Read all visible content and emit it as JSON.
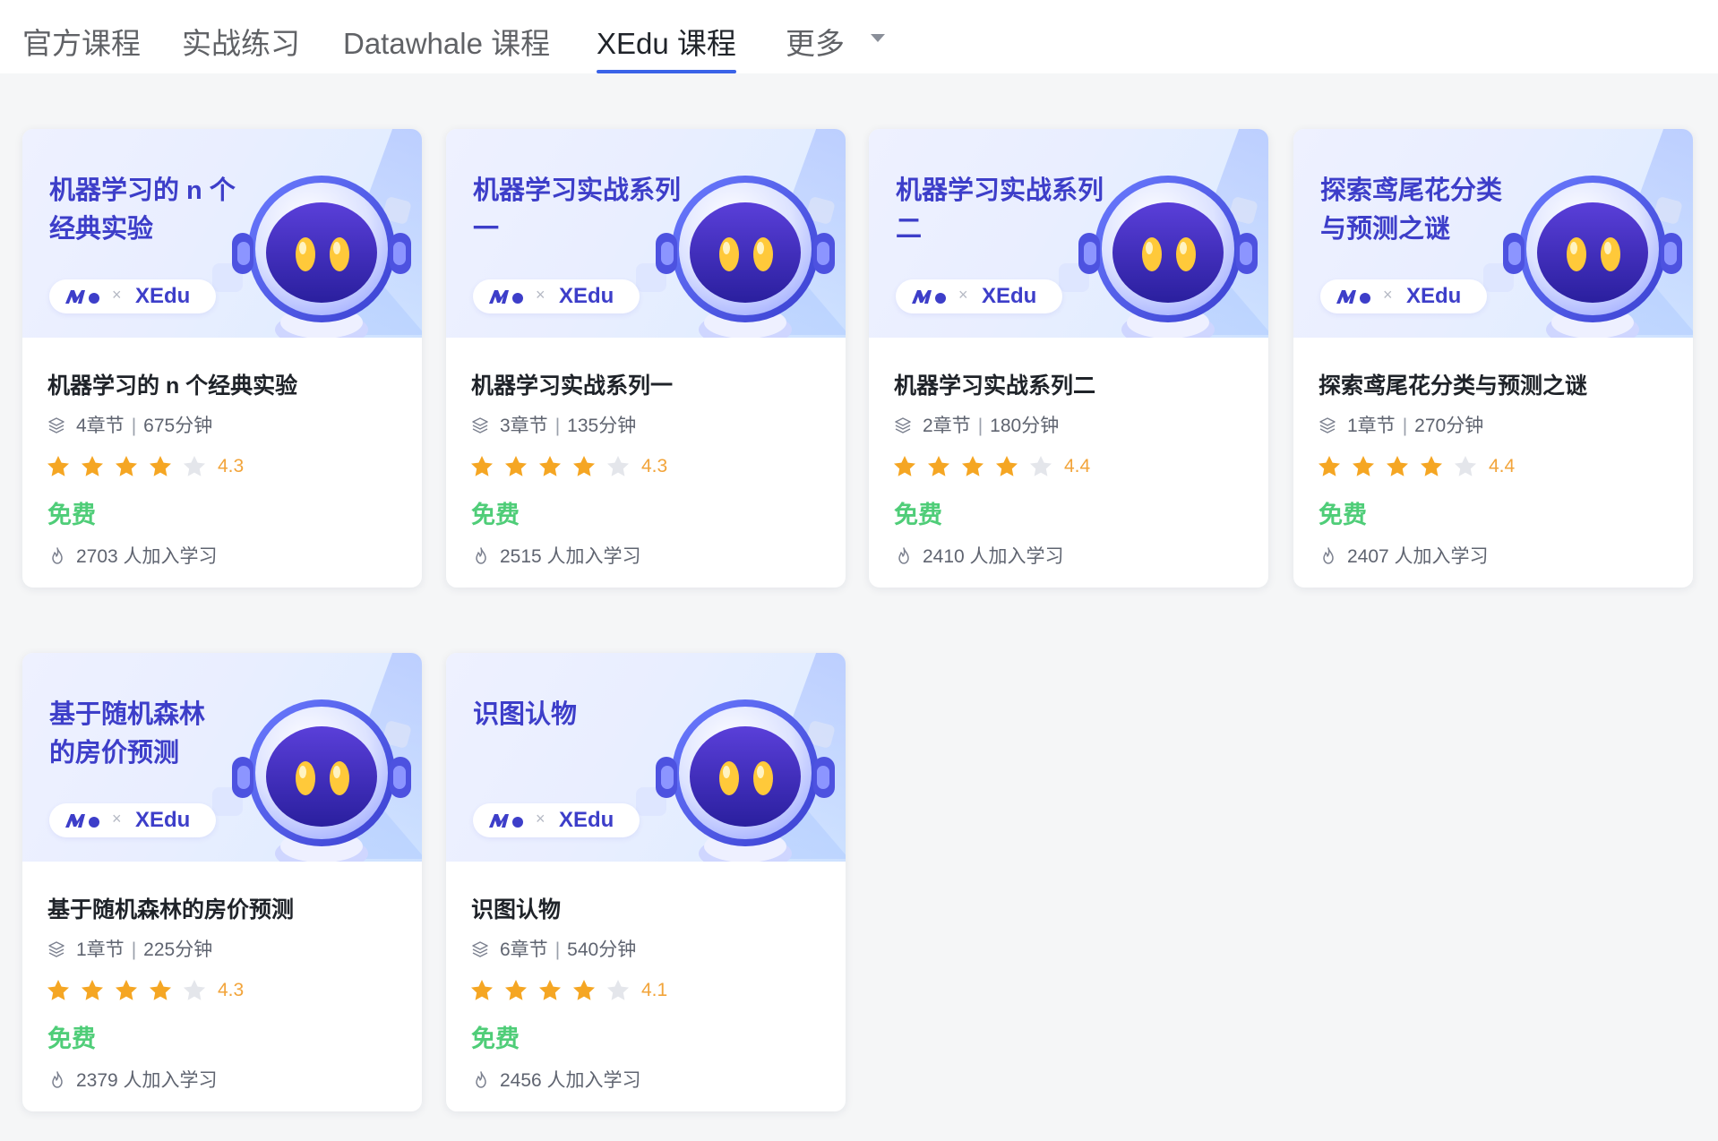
{
  "tabs": [
    {
      "label": "官方课程",
      "active": false
    },
    {
      "label": "实战练习",
      "active": false
    },
    {
      "label": "Datawhale 课程",
      "active": false
    },
    {
      "label": "XEdu 课程",
      "active": true
    },
    {
      "label": "更多",
      "active": false
    }
  ],
  "colors": {
    "accent": "#3a63e8",
    "banner_title": "#3d3ec9",
    "star_filled": "#f5a623",
    "star_empty": "#e4e6eb",
    "rating_text": "#f2a43a",
    "price": "#4fcd78"
  },
  "brand": {
    "x_mark": "×",
    "name": "XEdu"
  },
  "icons": {
    "tab_more": "chevron-down-icon",
    "chapters": "layers-icon",
    "learners": "flame-icon",
    "star": "star-icon"
  },
  "courses": [
    {
      "banner_line1": "机器学习的 n 个",
      "banner_line2": "经典实验",
      "title": "机器学习的 n 个经典实验",
      "chapters": "4章节",
      "separator": "|",
      "duration": "675分钟",
      "rating": 4.3,
      "rating_text": "4.3",
      "filled_stars": 4,
      "price": "免费",
      "learners": "2703 人加入学习"
    },
    {
      "banner_line1": "机器学习实战系列一",
      "banner_line2": "",
      "title": "机器学习实战系列一",
      "chapters": "3章节",
      "separator": "|",
      "duration": "135分钟",
      "rating": 4.3,
      "rating_text": "4.3",
      "filled_stars": 4,
      "price": "免费",
      "learners": "2515 人加入学习"
    },
    {
      "banner_line1": "机器学习实战系列二",
      "banner_line2": "",
      "title": "机器学习实战系列二",
      "chapters": "2章节",
      "separator": "|",
      "duration": "180分钟",
      "rating": 4.4,
      "rating_text": "4.4",
      "filled_stars": 4,
      "price": "免费",
      "learners": "2410 人加入学习"
    },
    {
      "banner_line1": "探索鸢尾花分类",
      "banner_line2": "与预测之谜",
      "title": "探索鸢尾花分类与预测之谜",
      "chapters": "1章节",
      "separator": "|",
      "duration": "270分钟",
      "rating": 4.4,
      "rating_text": "4.4",
      "filled_stars": 4,
      "price": "免费",
      "learners": "2407 人加入学习"
    },
    {
      "banner_line1": "基于随机森林",
      "banner_line2": "的房价预测",
      "title": "基于随机森林的房价预测",
      "chapters": "1章节",
      "separator": "|",
      "duration": "225分钟",
      "rating": 4.3,
      "rating_text": "4.3",
      "filled_stars": 4,
      "price": "免费",
      "learners": "2379 人加入学习"
    },
    {
      "banner_line1": "识图认物",
      "banner_line2": "",
      "title": "识图认物",
      "chapters": "6章节",
      "separator": "|",
      "duration": "540分钟",
      "rating": 4.1,
      "rating_text": "4.1",
      "filled_stars": 4,
      "price": "免费",
      "learners": "2456 人加入学习"
    }
  ]
}
